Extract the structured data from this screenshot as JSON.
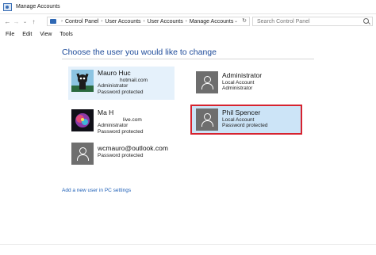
{
  "window": {
    "title": "Manage Accounts"
  },
  "address": {
    "crumbs": [
      "Control Panel",
      "User Accounts",
      "User Accounts",
      "Manage Accounts"
    ],
    "search_placeholder": "Search Control Panel"
  },
  "menu": [
    "File",
    "Edit",
    "View",
    "Tools"
  ],
  "heading": "Choose the user you would like to change",
  "accounts": [
    {
      "name": "Mauro Huc",
      "email": "hotmail.com",
      "role": "Administrator",
      "status": "Password protected"
    },
    {
      "name": "Ma H",
      "email": "live.com",
      "role": "Administrator",
      "status": "Password protected"
    },
    {
      "name": "wcmauro@outlook.com",
      "role": "",
      "status": "Password protected"
    },
    {
      "name": "Administrator",
      "type": "Local Account",
      "role": "Administrator"
    },
    {
      "name": "Phil Spencer",
      "type": "Local Account",
      "status": "Password protected"
    }
  ],
  "add_user_link": "Add a new user in PC settings",
  "colors": {
    "highlight_border": "#d6232f",
    "link": "#1d5fb7",
    "heading": "#1e4b9a"
  }
}
